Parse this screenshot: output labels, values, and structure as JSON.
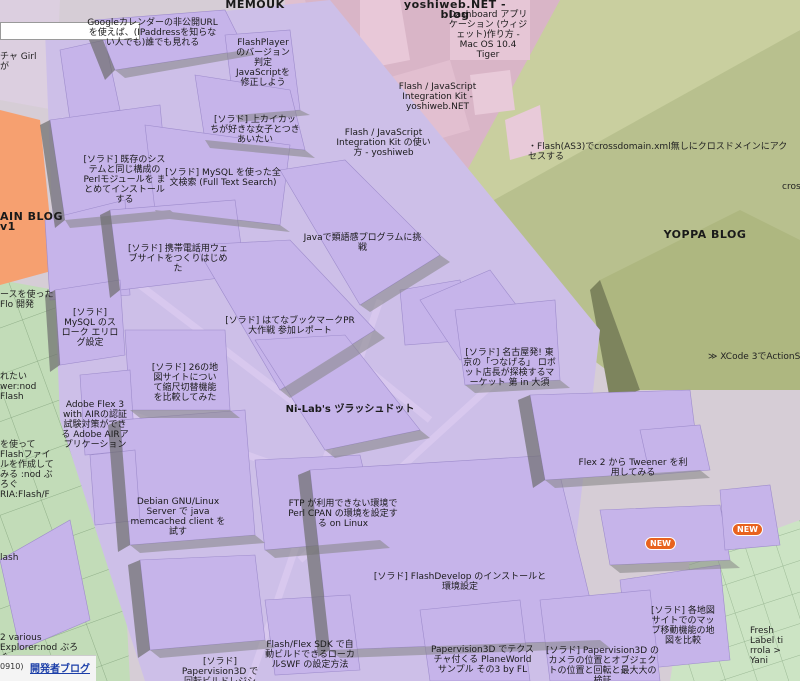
{
  "colors": {
    "purple": "#c3b2e8",
    "pink": "#dbb8c8",
    "green": "#b6c088",
    "orange": "#f8a270",
    "lightgreen": "#c0d8b8"
  },
  "blocks": {
    "memouk": "MEMOUK",
    "yoshiweb": "yoshiweb.NET - blog",
    "calendar": "Googleカレンダーの非公開URLを使えば、(IPaddressを知らない人でも)誰でも見れる",
    "flashplayer": "FlashPlayerのバージョン判定 JavaScriptを修正しよう",
    "dashboard": "Dashboard アプリケーション (ウィジェット)作り方 - Mac OS 10.4 Tiger",
    "flashjs_kit": "Flash / JavaScript Integration Kit - yoshiweb.NET",
    "flashjs_use": "Flash / JavaScript Integration Kit の使い方 - yoshiweb",
    "kakai": "[ソラド] 上カイカッちが好きな女子とつきあいたい",
    "crossdomain": "・Flash(AS3)でcrossdomain.xml無しにクロスドメインにアクセスする",
    "existing_sys": "[ソラド] 既存のシステムと同じ構成のPerlモジュールを まとめてインストールする",
    "mysql_search": "[ソラド] MySQL を使った全文検索 (Full Text Search)",
    "main_blog": "AIN BLOG v1",
    "mobile_web": "[ソラド] 携帯電話用ウェブサイトをつくりはじめた",
    "java_voice": "Javaで類語感プログラムに挑戦",
    "yoppa": "YOPPA BLOG",
    "cross_small": "cross",
    "flo_side": "ースを使ったFlo 開発",
    "mysql_err": "[ソラド] MySQL のスローク エリログ設定",
    "hatena": "[ソラド] はてなブックマークPR大作戦 参加レポート",
    "nagoya": "[ソラド] 名古屋発! 東京の「つなげる」 ロボット店長が探検するマーケット 第 in 大須",
    "xcode": "≫ XCode 3でActionScript",
    "side_rare": "れたいwer:nod Flash",
    "flv_360": "[ソラド] 26の地図サイトについて縮尺切替機能を比較してみた",
    "adobe_flex": "Adobe Flex 3 with AIRの認証試験対策ができる Adobe AIRアプリケーション",
    "nilab": "Ni-Lab's ヅラッシュドット",
    "side_flash": "を使ってFlashファイルを作成してみる :nod ぶろぐ RIA:Flash/F",
    "debian": "Debian GNU/Linux Server で java memcached client を試す",
    "flex2": "Flex 2 から Tweener を利用してみる",
    "ftp": "FTP が利用できない環境でPerl CPAN の環境を設定する on Linux",
    "flashdevelop": "[ソラド] FlashDevelop のインストールと環境設定",
    "flash_side": "lash",
    "new1": "NEW",
    "new2": "NEW",
    "map_compare": "[ソラド] 各地図サイトでのマップ移動機能の地図を比較",
    "explorer": "2 various Explorer:nod ぶろぐ RIA:Flash/Flex/Aj",
    "flex_sdk": "Flash/Flex SDK で自動ビルドできるローカルSWF の設定方法",
    "papervision1": "[ソラド] Papervision3D で回転ビルドレジションを...",
    "papervision2": "Papervision3D でテクスチャ付くる PlaneWorld サンプル その3 by FL",
    "papervision3": "[ソラド] Papervision3D のカメラの位置とオブジェクトの位置と回転と最大大の検証",
    "fresh_label": "Fresh Label ti rrola > Yani",
    "left_top": "チャ Girlが",
    "corner_code": "0910)",
    "dev_blog": "開発者ブログ"
  }
}
